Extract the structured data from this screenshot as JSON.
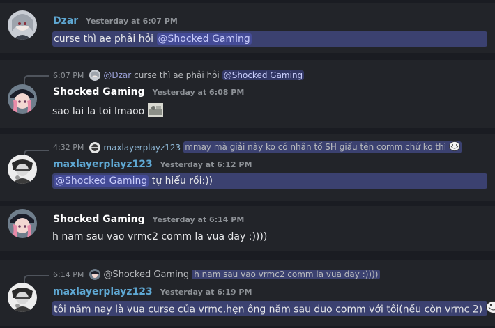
{
  "messages": [
    {
      "author": "Dzar",
      "author_color": "#5fa8d3",
      "timestamp": "Yesterday at 6:07 PM",
      "text": "curse thì ae phải hỏi",
      "mention": "@Shocked Gaming"
    },
    {
      "reply": {
        "time": "6:07 PM",
        "author": "@Dzar",
        "text": "curse thì ae phải hỏi",
        "mention": "@Shocked Gaming"
      },
      "author": "Shocked Gaming",
      "author_color": "#ffffff",
      "timestamp": "Yesterday at 6:08 PM",
      "text": "sao lai la toi lmaoo",
      "emoji": "image-emoji"
    },
    {
      "reply": {
        "time": "4:32 PM",
        "author": "maxlayerplayz123",
        "text": "mmay mà giải này ko có nhân tố SH giấu tên comm chứ ko thì",
        "emoji": "trollface-emoji"
      },
      "author": "maxlayerplayz123",
      "author_color": "#5fa8d3",
      "timestamp": "Yesterday at 6:12 PM",
      "mention": "@Shocked Gaming",
      "text": "tự hiểu rồi:))"
    },
    {
      "author": "Shocked Gaming",
      "author_color": "#ffffff",
      "timestamp": "Yesterday at 6:14 PM",
      "text": "h nam sau vao vrmc2 comm la vua day :))))"
    },
    {
      "reply": {
        "time": "6:14 PM",
        "author": "@Shocked Gaming",
        "text": "h nam sau vao vrmc2 comm la vua day :))))"
      },
      "author": "maxlayerplayz123",
      "author_color": "#5fa8d3",
      "timestamp": "Yesterday at 6:19 PM",
      "text": "tôi năm nay là vua curse của vrmc,hẹn ông năm sau duo comm với tôi(nếu còn vrmc 2)",
      "emoji": "trollface-emoji"
    }
  ]
}
